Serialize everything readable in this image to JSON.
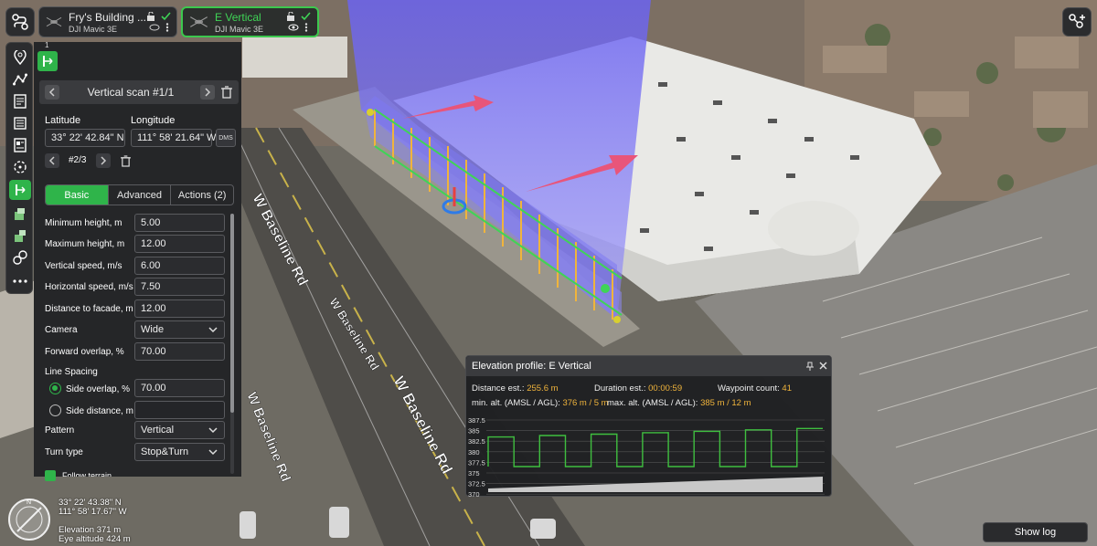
{
  "missions": [
    {
      "title": "Fry's Building ...",
      "drone": "DJI Mavic 3E",
      "active": false
    },
    {
      "title": "E Vertical",
      "drone": "DJI Mavic 3E",
      "active": true
    }
  ],
  "map_labels": {
    "street_1": "W Baseline Rd",
    "street_2": "W Baseline Rd",
    "street_3": "W Baseline Rd",
    "street_4": "W Baseline Rd"
  },
  "panel": {
    "number": "1",
    "scan_title": "Vertical scan #1/1",
    "latitude_label": "Latitude",
    "longitude_label": "Longitude",
    "latitude_value": "33° 22' 42.84\" N",
    "longitude_value": "111° 58' 21.64\" W",
    "dms_label": "DMS",
    "point_counter": "#2/3",
    "tabs": [
      "Basic",
      "Advanced",
      "Actions (2)"
    ],
    "fields": [
      {
        "label": "Minimum height, m",
        "value": "5.00"
      },
      {
        "label": "Maximum height, m",
        "value": "12.00"
      },
      {
        "label": "Vertical speed, m/s",
        "value": "6.00"
      },
      {
        "label": "Horizontal speed, m/s",
        "value": "7.50"
      },
      {
        "label": "Distance to facade, m",
        "value": "12.00"
      }
    ],
    "camera_label": "Camera",
    "camera_value": "Wide",
    "forward_overlap_label": "Forward overlap, %",
    "forward_overlap_value": "70.00",
    "line_spacing_label": "Line Spacing",
    "side_overlap_label": "Side overlap, %",
    "side_overlap_value": "70.00",
    "side_distance_label": "Side distance, m",
    "side_distance_value": "",
    "pattern_label": "Pattern",
    "pattern_value": "Vertical",
    "turn_type_label": "Turn type",
    "turn_type_value": "Stop&Turn",
    "follow_terrain_label": "Follow terrain"
  },
  "readout": {
    "lat": "33° 22' 43.38\" N",
    "lon": "111° 58' 17.67\" W",
    "elevation": "Elevation 371 m",
    "eye_altitude": "Eye altitude 424 m"
  },
  "elevation_profile": {
    "title": "Elevation profile: E Vertical",
    "distance_label": "Distance est.:",
    "distance_value": "255.6 m",
    "duration_label": "Duration est.:",
    "duration_value": "00:00:59",
    "waypoint_label": "Waypoint count:",
    "waypoint_value": "41",
    "min_alt_label": "min. alt. (AMSL / AGL):",
    "min_alt_value": "376 m / 5 m",
    "max_alt_label": "max. alt. (AMSL / AGL):",
    "max_alt_value": "385 m / 12 m",
    "y_ticks": [
      "387.5",
      "385",
      "382.5",
      "380",
      "377.5",
      "375",
      "372.5",
      "370"
    ],
    "line_color": "#3fbf3f"
  },
  "show_log": "Show log",
  "colors": {
    "accent": "#2fb44a",
    "highlight": "#f0b43c"
  }
}
